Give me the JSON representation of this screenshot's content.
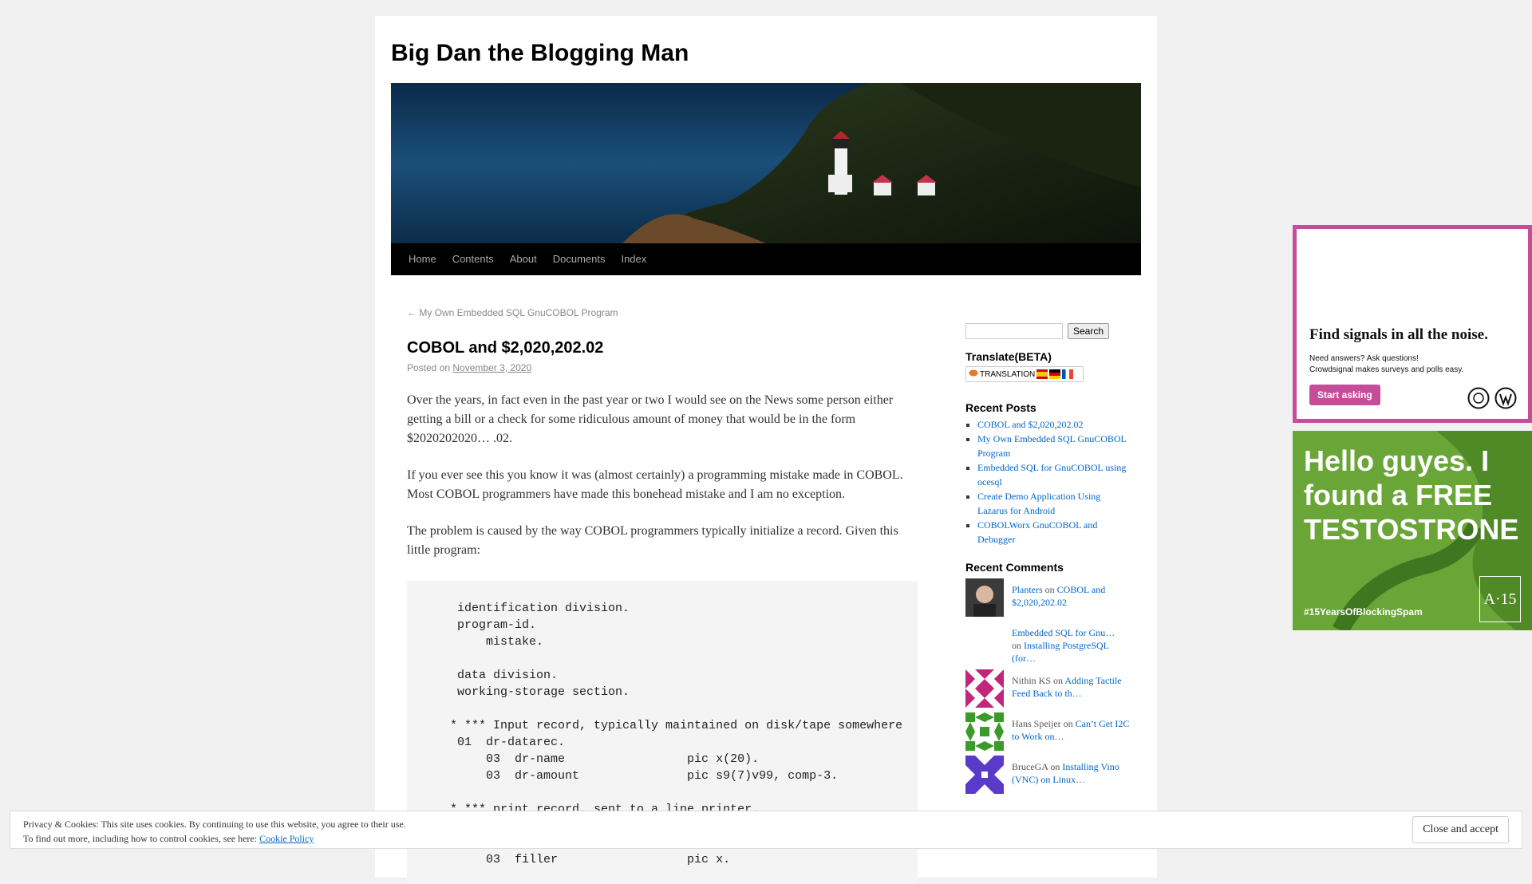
{
  "site": {
    "title": "Big Dan the Blogging Man"
  },
  "nav": {
    "items": [
      "Home",
      "Contents",
      "About",
      "Documents",
      "Index"
    ]
  },
  "post": {
    "prev_link": "← My Own Embedded SQL GnuCOBOL Program",
    "title": "COBOL and $2,020,202.02",
    "posted_on_label": "Posted on",
    "date": "November 3, 2020",
    "paragraphs": [
      "Over the years, in fact even in the past year or two I would see on the News some person either getting a bill or a check for some ridiculous amount of money that would be in the form $2020202020… .02.",
      "If you ever see this you know it was (almost certainly) a programming mistake made in COBOL. Most COBOL programmers have made this bonehead mistake and I am no exception.",
      "The problem is caused by the way COBOL programmers typically initialize a record. Given this little program:"
    ],
    "code": "       identification division.\n       program-id.\n           mistake.\n\n       data division.\n       working-storage section.\n\n      * *** Input record, typically maintained on disk/tape somewhere\n       01  dr-datarec.\n           03  dr-name                 pic x(20).\n           03  dr-amount               pic s9(7)v99, comp-3.\n\n      * *** print record, sent to a line printer.\n\n\n           03  filler                  pic x."
  },
  "sidebar": {
    "search_button": "Search",
    "search_value": "",
    "translate_title": "Translate(BETA)",
    "translate_label": "TRANSLATION",
    "recent_posts_title": "Recent Posts",
    "recent_posts": [
      "COBOL and $2,020,202.02",
      "My Own Embedded SQL GnuCOBOL Program",
      "Embedded SQL for GnuCOBOL using ocesql",
      "Create Demo Application Using Lazarus for Android",
      "COBOLWorx GnuCOBOL and Debugger"
    ],
    "recent_comments_title": "Recent Comments",
    "recent_comments": [
      {
        "author": "Planters",
        "on": "on",
        "post": "COBOL and $2,020,202.02"
      },
      {
        "author": "Embedded SQL for Gnu…",
        "on": "on",
        "post": "Installing PostgreSQL (for…"
      },
      {
        "author": "Nithin KS",
        "on": "on",
        "post": "Adding Tactile Feed Back to th…"
      },
      {
        "author": "Hans Speijer",
        "on": "on",
        "post": "Can’t Get I2C to Work on…"
      },
      {
        "author": "BruceGA",
        "on": "on",
        "post": "Installing Vino (VNC) on Linux…"
      }
    ]
  },
  "ads": {
    "crowdsignal": {
      "headline": "Find signals in all the noise.",
      "line1": "Need answers? Ask questions!",
      "line2": "Crowdsignal makes surveys and polls easy.",
      "button": "Start asking"
    },
    "akismet": {
      "headline": "Hello guyes. I found a FREE TESTOSTRONE",
      "tag": "#15YearsOfBlockingSpam",
      "logo": "A·15"
    }
  },
  "cookie": {
    "line1": "Privacy & Cookies: This site uses cookies. By continuing to use this website, you agree to their use.",
    "line2_prefix": "To find out more, including how to control cookies, see here:",
    "link": "Cookie Policy",
    "close_button": "Close and accept"
  },
  "colors": {
    "nav_bg": "#000000",
    "link": "#0066cc",
    "ad_pink": "#c74d9a",
    "ad_green": "#6aa637"
  }
}
